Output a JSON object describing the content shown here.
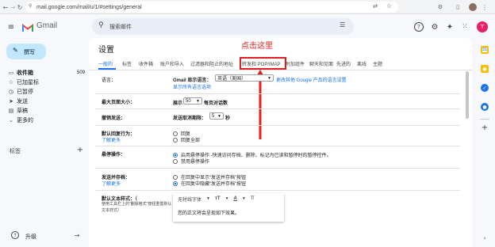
{
  "browser": {
    "url": "mail.google.com/mail/u/1/#settings/general"
  },
  "app": {
    "name": "Gmail",
    "search_placeholder": "搜索邮件",
    "avatar_letter": "T"
  },
  "compose": "撰写",
  "sidebar": {
    "items": [
      {
        "label": "收件箱",
        "count": "509",
        "icon": "inbox-icon",
        "glyph": "▭"
      },
      {
        "label": "已加星标",
        "icon": "star-icon",
        "glyph": "☆"
      },
      {
        "label": "已暂停",
        "icon": "clock-icon",
        "glyph": "◷"
      },
      {
        "label": "发送",
        "icon": "send-icon",
        "glyph": "➤"
      },
      {
        "label": "草稿",
        "icon": "draft-icon",
        "glyph": "▤"
      },
      {
        "label": "更多的",
        "icon": "chevron-down-icon",
        "glyph": "⌄"
      }
    ],
    "labels_heading": "标签",
    "upgrade": "升级"
  },
  "settings": {
    "title": "设置",
    "annotation": "点击这里",
    "tabs": [
      "一般的",
      "标签",
      "收件箱",
      "账户和导入",
      "过滤器和阻止的地址",
      "转发和 POP/IMAP",
      "附加组件",
      "聊天和见面",
      "先进的",
      "离线",
      "主题"
    ],
    "language": {
      "label": "语言：",
      "display_label": "Gmail 显示语言：",
      "value": "英语（美国）",
      "change_link": "更改其他 Google 产品的语言设置",
      "show_all": "显示所有语言选项"
    },
    "page_size": {
      "label": "最大页面大小：",
      "prefix": "展示",
      "value": "50",
      "suffix": "每页对话数"
    },
    "undo": {
      "label": "撤销发送：",
      "prefix": "发送取消期限：",
      "value": "5",
      "suffix": "秒"
    },
    "reply": {
      "label": "默认回复行为：",
      "link": "了解更多",
      "options": [
        "回复",
        "回复全部"
      ]
    },
    "hover": {
      "label": "悬停操作：",
      "options": [
        "启用悬停操作 -快速访问存档、删除、标记为已读和暂停时的暂停控件。",
        "禁用悬停操作"
      ]
    },
    "send_archive": {
      "label": "发送并存档：",
      "link": "了解更多",
      "options": [
        "在回复中显示“发送并存档”按钮",
        "在回复中隐藏“发送并存档”按钮"
      ]
    },
    "default_text": {
      "label": "默认文本样式：（",
      "hint": "使用工具栏上的“删除格式”按钮重置默认文本样式）",
      "font": "无衬线字体",
      "sample": "您的正文将会呈现如下效果。"
    }
  },
  "colors": {
    "accent": "#1a73e8",
    "annotation_red": "#e02020",
    "compose_bg": "#c2e7ff"
  }
}
